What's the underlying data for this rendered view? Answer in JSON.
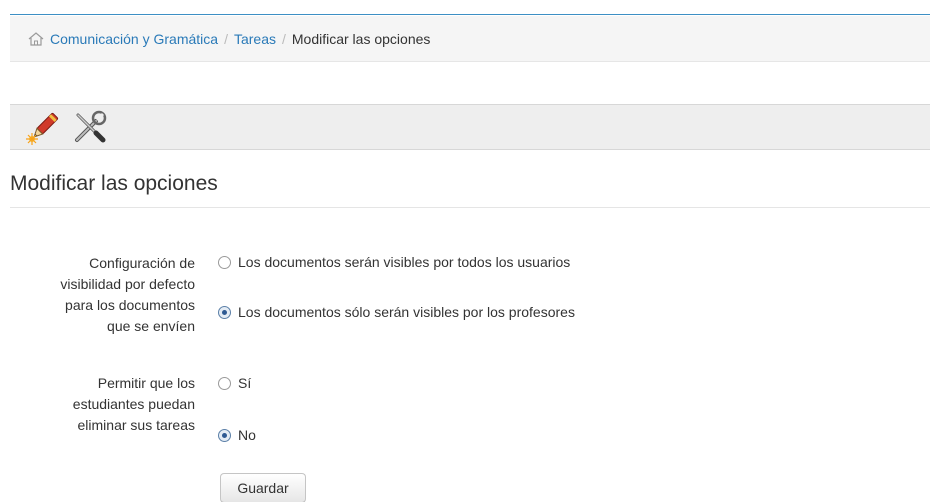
{
  "breadcrumb": {
    "items": [
      "Comunicación y Gramática",
      "Tareas"
    ],
    "separator": "/",
    "current": "Modificar las opciones"
  },
  "toolbar": {
    "icons": [
      "pencil-icon",
      "tools-icon"
    ]
  },
  "page": {
    "title": "Modificar las opciones"
  },
  "form": {
    "visibility": {
      "label_lines": [
        "Configuración de",
        "visibilidad por defecto",
        "para los documentos",
        "que se envíen"
      ],
      "options": [
        "Los documentos serán visibles por todos los usuarios",
        "Los documentos sólo serán visibles por los profesores"
      ],
      "selected": 1
    },
    "delete": {
      "label_lines": [
        "Permitir que los",
        "estudiantes puedan",
        "eliminar sus tareas"
      ],
      "options": [
        "Sí",
        "No"
      ],
      "selected": 1
    },
    "save_label": "Guardar"
  },
  "colors": {
    "link": "#2a7ab8",
    "accent_line": "#3d8fc4",
    "toolbar_bg": "#eeeeee"
  }
}
